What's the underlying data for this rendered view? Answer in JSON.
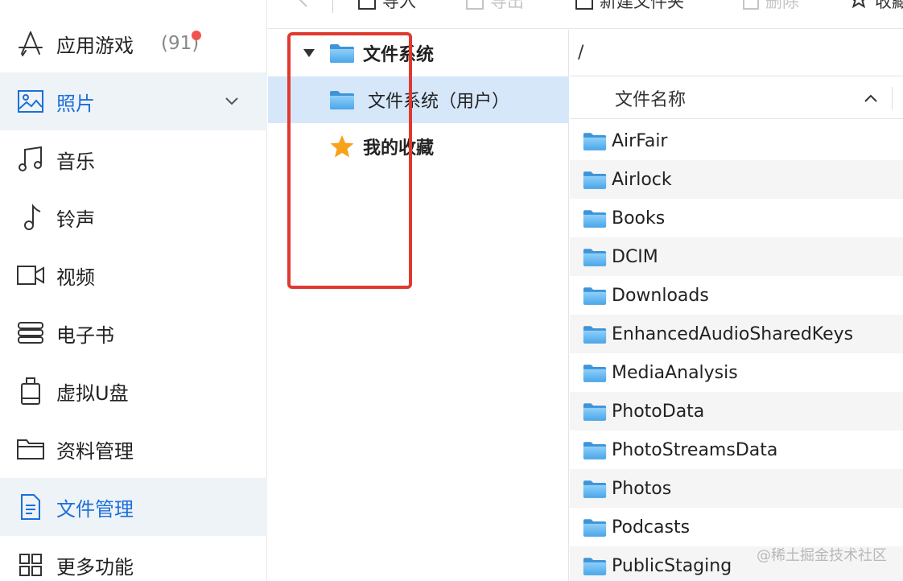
{
  "sidebar": {
    "items": [
      {
        "label": "应用游戏",
        "badge": "(91)",
        "icon": "app-store-icon"
      },
      {
        "label": "照片",
        "icon": "photo-icon"
      },
      {
        "label": "音乐",
        "icon": "music-icon"
      },
      {
        "label": "铃声",
        "icon": "ringtone-icon"
      },
      {
        "label": "视频",
        "icon": "video-icon"
      },
      {
        "label": "电子书",
        "icon": "ebook-icon"
      },
      {
        "label": "虚拟U盘",
        "icon": "usb-drive-icon"
      },
      {
        "label": "资料管理",
        "icon": "folder-icon"
      },
      {
        "label": "文件管理",
        "icon": "document-icon"
      },
      {
        "label": "更多功能",
        "icon": "grid-icon"
      }
    ]
  },
  "toolbar": {
    "import_label": "导入",
    "export_label": "导出",
    "new_folder_label": "新建文件夹",
    "delete_label": "删除",
    "favorite_label": "收藏"
  },
  "tree": {
    "root_label": "文件系统",
    "user_label": "文件系统（用户）",
    "favorites_label": "我的收藏"
  },
  "files": {
    "path": "/",
    "column_name": "文件名称",
    "rows": [
      "AirFair",
      "Airlock",
      "Books",
      "DCIM",
      "Downloads",
      "EnhancedAudioSharedKeys",
      "MediaAnalysis",
      "PhotoData",
      "PhotoStreamsData",
      "Photos",
      "Podcasts",
      "PublicStaging"
    ]
  },
  "colors": {
    "accent": "#1a6fd8",
    "selected_bg": "#d6e7fa",
    "highlight_box": "#e0392f",
    "badge_dot": "#f0544f",
    "folder_blue": "#5fb0ec"
  },
  "watermark": "@稀土掘金技术社区"
}
